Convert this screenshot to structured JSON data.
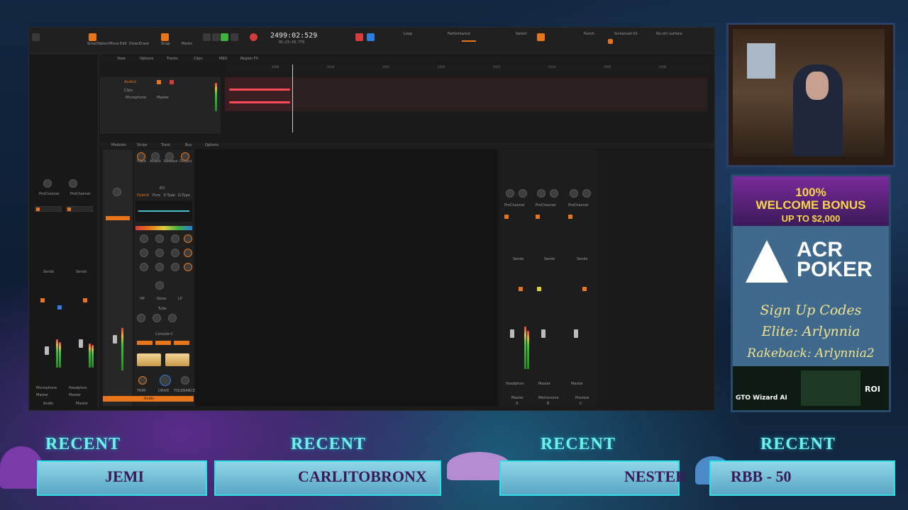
{
  "daw": {
    "timecode": "2499:02:529",
    "timecode_sub": "01:23:16.779",
    "tools": [
      "Smart",
      "Select",
      "Move",
      "Edit",
      "Draw",
      "Erase"
    ],
    "toolbar_labels": [
      "Snap",
      "Marks",
      "Loop",
      "Performance",
      "Select",
      "Punch",
      "Screenset 01",
      "No ctrl surface"
    ],
    "menu": [
      "View",
      "Options",
      "Tracks",
      "Clips",
      "MIDI",
      "Region FX"
    ],
    "console_menu": [
      "Modules",
      "Strips",
      "Track",
      "Bus",
      "Options"
    ],
    "track": {
      "name": "Audio1",
      "input": "Microphone",
      "output": "Master",
      "view": "Clips"
    },
    "timeline_ticks": [
      "2498",
      "2500",
      "2501",
      "2502",
      "2503",
      "2504",
      "2505",
      "2506"
    ],
    "prochannel": {
      "label": "ProChannel",
      "modules": [
        "Input",
        "Attack",
        "Release",
        "Output",
        "EQ",
        "Hybrid",
        "Pure",
        "E-Type",
        "G-Type",
        "HP",
        "Gloss",
        "LP",
        "Tube",
        "Drive",
        "Console-C",
        "TRIM",
        "DRIVE",
        "TOLERANCE"
      ],
      "bottom_label": "Audio"
    },
    "left_strips": {
      "labels": [
        "ProChannel",
        "ProChannel"
      ],
      "sends": "Sends",
      "inputs": [
        "Microphone",
        "Headphon"
      ],
      "outputs": [
        "Master",
        "Master"
      ],
      "names": [
        "Audio",
        "Master"
      ]
    },
    "right_strips": {
      "labels": [
        "ProChannel",
        "ProChannel",
        "ProChannel"
      ],
      "outputs": [
        "Headphon",
        "Master",
        "Master"
      ],
      "names": [
        "Master",
        "Metronome",
        "Preview"
      ],
      "sends": [
        "Sends",
        "Sends",
        "Sends"
      ],
      "letters": [
        "A",
        "B",
        "C"
      ]
    }
  },
  "ad": {
    "bonus_line1": "100%",
    "bonus_line2": "WELCOME BONUS",
    "amount": "UP TO $2,000",
    "logo_line1": "ACR",
    "logo_line2": "POKER",
    "signup": "Sign Up Codes",
    "elite": "Elite: Arlynnia",
    "rakeback": "Rakeback: Arlynnia2",
    "gto": "GTO Wizard AI",
    "roi": "ROI"
  },
  "banner": {
    "recent_label": "RECENT",
    "names": [
      "JEMI",
      "CARLITOBRONX",
      "NESTER",
      "RBB - 50"
    ]
  },
  "colors": {
    "accent": "#e8751a",
    "record": "#d63b3b",
    "play": "#3fb23f",
    "recent_text": "#6ff0e8"
  }
}
